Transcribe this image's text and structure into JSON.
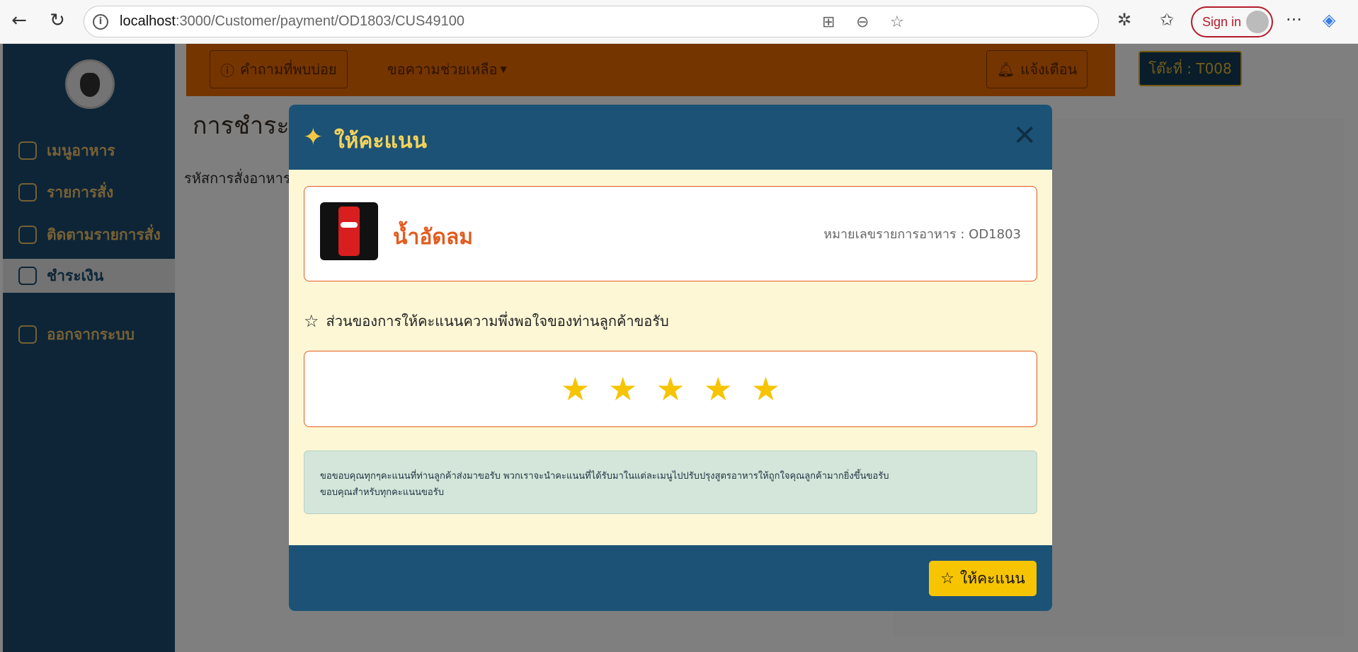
{
  "browser": {
    "url_host": "localhost",
    "url_path": ":3000/Customer/payment/OD1803/CUS49100",
    "sign_in": "Sign in"
  },
  "sidebar": {
    "items": [
      {
        "label": "เมนูอาหาร"
      },
      {
        "label": "รายการสั่ง"
      },
      {
        "label": "ติดตามรายการสั่ง"
      },
      {
        "label": "ชำระเงิน"
      },
      {
        "label": "ออกจากระบบ"
      }
    ]
  },
  "topbar": {
    "faq": "คำถามที่พบบ่อย",
    "help": "ขอความช่วยเหลือ",
    "notify": "แจ้งเตือน",
    "table": "โต๊ะที่ : T008"
  },
  "page": {
    "title": "การชำระเงิน",
    "order_label": "รหัสการสั่งอาหาร"
  },
  "modal": {
    "title": "ให้คะแนน",
    "item_name": "น้ำอัดลม",
    "order_no": "หมายเลขรายการอาหาร : OD1803",
    "question": "ส่วนของการให้คะแนนความพึ่งพอใจของท่านลูกค้าขอรับ",
    "rating": 5,
    "star_glyph": "★",
    "note_line1": "ขอขอบคุณทุกๆคะแนนที่ท่านลูกค้าส่งมาขอรับ พวกเราจะนำคะแนนที่ได้รับมาในแต่ละเมนูไปปรับปรุงสูตรอาหารให้ถูกใจคุณลูกค้ามากยิ่งขึ้นขอรับ",
    "note_line2": "ขอบคุณสำหรับทุกคะแนนขอรับ",
    "submit": "ให้คะแนน"
  },
  "colors": {
    "sidebar": "#1a4a6e",
    "topbar": "#e86a00",
    "modal_header": "#1c5275",
    "accent": "#f6c400",
    "item_name": "#e35b1e"
  }
}
